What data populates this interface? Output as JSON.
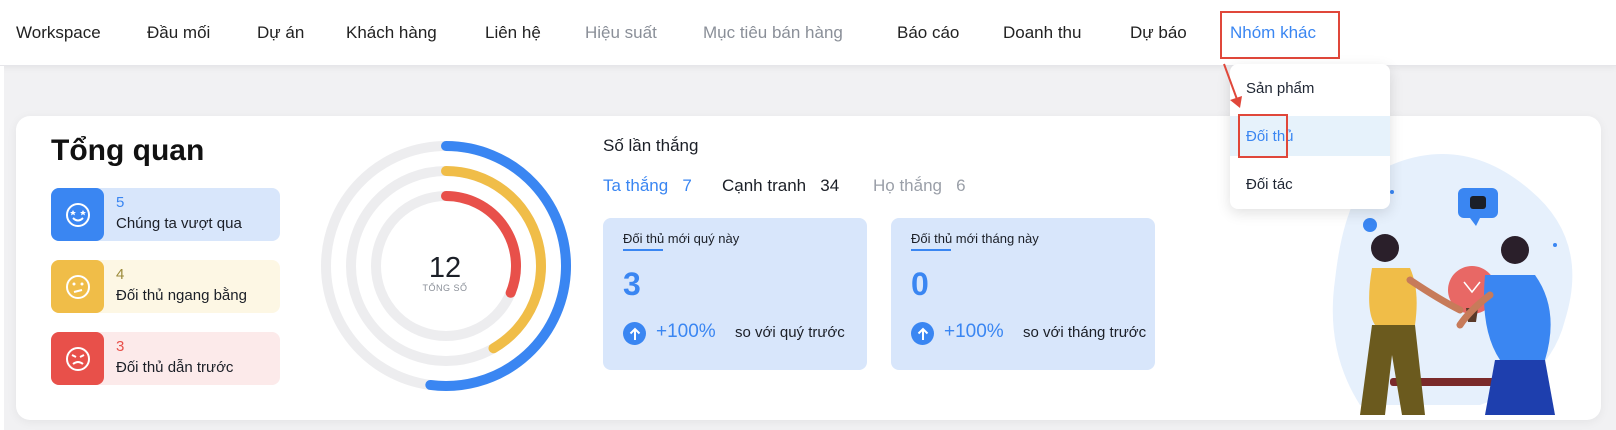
{
  "nav": {
    "items": [
      {
        "label": "Workspace",
        "state": "normal"
      },
      {
        "label": "Đầu mối",
        "state": "normal"
      },
      {
        "label": "Dự án",
        "state": "normal"
      },
      {
        "label": "Khách hàng",
        "state": "normal"
      },
      {
        "label": "Liên hệ",
        "state": "normal"
      },
      {
        "label": "Hiệu suất",
        "state": "muted"
      },
      {
        "label": "Mục tiêu bán hàng",
        "state": "muted"
      },
      {
        "label": "Báo cáo",
        "state": "normal"
      },
      {
        "label": "Doanh thu",
        "state": "normal"
      },
      {
        "label": "Dự báo",
        "state": "normal"
      },
      {
        "label": "Nhóm khác",
        "state": "active"
      }
    ]
  },
  "dropdown": {
    "items": [
      {
        "label": "Sản phẩm"
      },
      {
        "label": "Đối thủ",
        "active": true
      },
      {
        "label": "Đối tác"
      }
    ]
  },
  "overview": {
    "title": "Tổng quan",
    "stats": [
      {
        "value": "5",
        "label": "Chúng ta vượt qua",
        "color": "#3a86f2",
        "bg": "#d8e6fb",
        "icon": "star-eyes-face-icon"
      },
      {
        "value": "4",
        "label": "Đối thủ ngang bằng",
        "color": "#f0bd48",
        "bg": "#fdf7e4",
        "icon": "neutral-face-icon"
      },
      {
        "value": "3",
        "label": "Đối thủ dẫn trước",
        "color": "#e8504a",
        "bg": "#fceaea",
        "icon": "angry-face-icon"
      }
    ],
    "total": "12",
    "total_label": "TỔNG SỐ"
  },
  "wins": {
    "title": "Số lần thắng",
    "items": [
      {
        "label": "Ta thắng",
        "value": "7",
        "color": "#3a86f2"
      },
      {
        "label": "Cạnh tranh",
        "value": "34",
        "color": "#1b1f27"
      },
      {
        "label": "Họ thắng",
        "value": "6",
        "color": "#9a9fa8"
      }
    ]
  },
  "cards": [
    {
      "title": "Đối thủ mới quý này",
      "value": "3",
      "change": "+100%",
      "compare": "so với quý trước"
    },
    {
      "title": "Đối thủ mới tháng này",
      "value": "0",
      "change": "+100%",
      "compare": "so với tháng trước"
    }
  ]
}
